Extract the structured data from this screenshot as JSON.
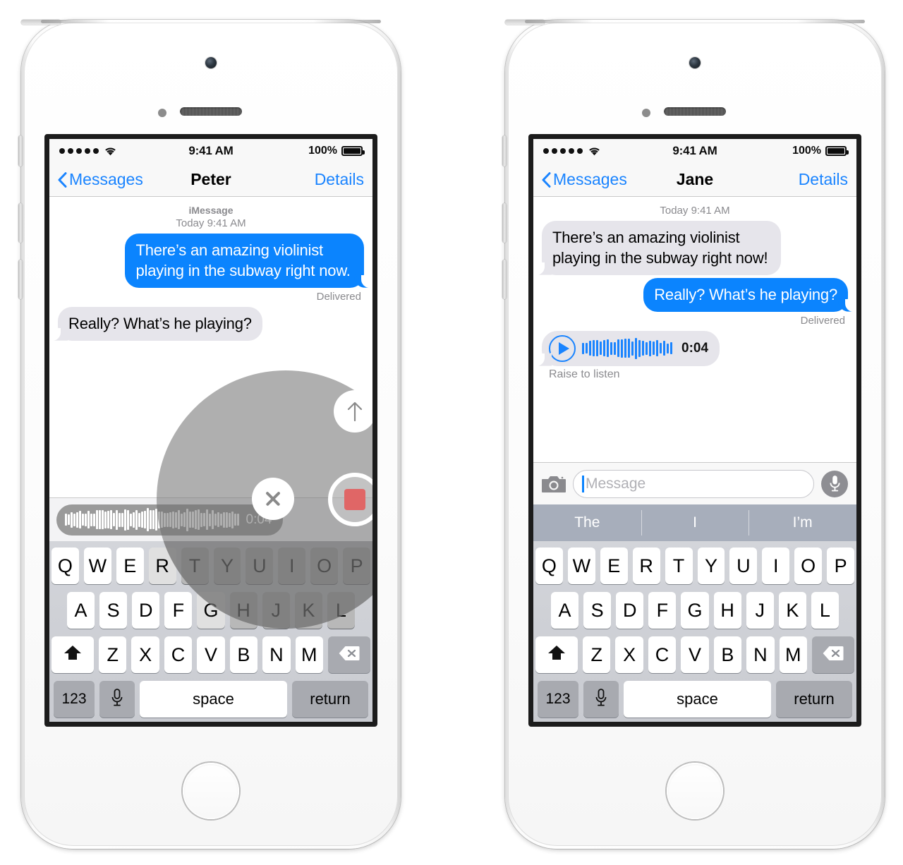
{
  "phones": [
    {
      "id": "left",
      "status_bar": {
        "signal_dots": 5,
        "wifi_icon": "wifi-icon",
        "time": "9:41 AM",
        "battery_percent": "100%",
        "battery_icon": "battery-full-icon"
      },
      "nav": {
        "back_label": "Messages",
        "back_icon": "chevron-left-icon",
        "title": "Peter",
        "details_label": "Details"
      },
      "conversation": {
        "service_label": "iMessage",
        "timestamp": "Today 9:41 AM",
        "messages": [
          {
            "direction": "out",
            "text": "There’s an amazing violinist playing in the subway right now."
          },
          {
            "direction": "status",
            "text": "Delivered"
          },
          {
            "direction": "in",
            "text": "Really? What’s he playing?"
          }
        ]
      },
      "recording_bar": {
        "duration": "0:04",
        "waveform_icon": "audio-waveform-icon"
      },
      "overlay": {
        "send_icon": "arrow-up-icon",
        "cancel_icon": "close-x-icon",
        "stop_icon": "stop-record-icon"
      },
      "keyboard": {
        "row1": [
          "Q",
          "W",
          "E",
          "R",
          "T",
          "Y",
          "U",
          "I",
          "O",
          "P"
        ],
        "row2": [
          "A",
          "S",
          "D",
          "F",
          "G",
          "H",
          "J",
          "K",
          "L"
        ],
        "row3": [
          "Z",
          "X",
          "C",
          "V",
          "B",
          "N",
          "M"
        ],
        "shift_icon": "shift-arrow-icon",
        "backspace_icon": "backspace-icon",
        "numbers_label": "123",
        "mic_icon": "microphone-icon",
        "space_label": "space",
        "return_label": "return"
      },
      "predictive": null
    },
    {
      "id": "right",
      "status_bar": {
        "signal_dots": 5,
        "wifi_icon": "wifi-icon",
        "time": "9:41 AM",
        "battery_percent": "100%",
        "battery_icon": "battery-full-icon"
      },
      "nav": {
        "back_label": "Messages",
        "back_icon": "chevron-left-icon",
        "title": "Jane",
        "details_label": "Details"
      },
      "conversation": {
        "service_label": "",
        "timestamp": "Today 9:41 AM",
        "messages": [
          {
            "direction": "in",
            "text": "There’s an amazing violinist playing in the subway right now!"
          },
          {
            "direction": "out",
            "text": "Really? What’s he playing?"
          },
          {
            "direction": "status",
            "text": "Delivered"
          }
        ],
        "audio_message": {
          "play_icon": "play-icon",
          "waveform_icon": "audio-waveform-icon",
          "duration": "0:04",
          "hint": "Raise to listen"
        }
      },
      "input_bar": {
        "camera_icon": "camera-icon",
        "placeholder": "Message",
        "value": "",
        "mic_icon": "microphone-icon"
      },
      "predictive": [
        "The",
        "I",
        "I’m"
      ],
      "keyboard": {
        "row1": [
          "Q",
          "W",
          "E",
          "R",
          "T",
          "Y",
          "U",
          "I",
          "O",
          "P"
        ],
        "row2": [
          "A",
          "S",
          "D",
          "F",
          "G",
          "H",
          "J",
          "K",
          "L"
        ],
        "row3": [
          "Z",
          "X",
          "C",
          "V",
          "B",
          "N",
          "M"
        ],
        "shift_icon": "shift-arrow-icon",
        "backspace_icon": "backspace-icon",
        "numbers_label": "123",
        "mic_icon": "microphone-icon",
        "space_label": "space",
        "return_label": "return"
      }
    }
  ],
  "colors": {
    "imessage_blue": "#0b84fe",
    "bubble_grey": "#e6e5eb",
    "tint_blue": "#1a84ff",
    "meta_grey": "#8a8a8e",
    "keyboard_bg": "#ccced3",
    "predictive_bg": "#a7aebb",
    "record_red": "#e06666"
  }
}
